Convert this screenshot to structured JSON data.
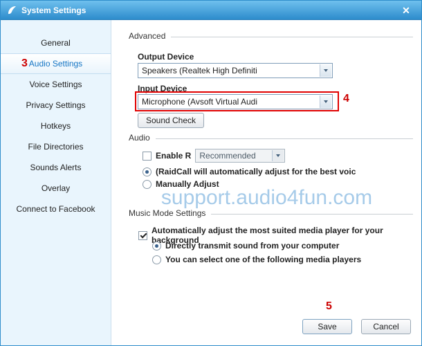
{
  "window": {
    "title": "System Settings",
    "close_label": "✕"
  },
  "sidebar": {
    "items": [
      {
        "label": "General",
        "selected": false
      },
      {
        "label": "Audio Settings",
        "selected": true
      },
      {
        "label": "Voice Settings",
        "selected": false
      },
      {
        "label": "Privacy Settings",
        "selected": false
      },
      {
        "label": "Hotkeys",
        "selected": false
      },
      {
        "label": "File Directories",
        "selected": false
      },
      {
        "label": "Sounds Alerts",
        "selected": false
      },
      {
        "label": "Overlay",
        "selected": false
      },
      {
        "label": "Connect to Facebook",
        "selected": false
      }
    ]
  },
  "annotations": {
    "step3": "3",
    "step4": "4",
    "step5": "5"
  },
  "content": {
    "advanced": {
      "header": "Advanced",
      "output_label": "Output Device",
      "output_value": "Speakers (Realtek High Definiti",
      "input_label": "Input Device",
      "input_value": "Microphone (Avsoft Virtual Audi",
      "sound_check": "Sound Check"
    },
    "audio": {
      "header": "Audio",
      "enable_label": "Enable R",
      "recommended_value": "Recommended",
      "auto_label": "(RaidCall will automatically adjust for the best voic",
      "manual_label": "Manually Adjust"
    },
    "watermark": "support.audio4fun.com",
    "music": {
      "header": "Music Mode Settings",
      "auto_label": "Automatically adjust the most suited media player for your background",
      "direct_label": "Directly transmit sound from your computer",
      "select_label": "You can select one of the following media players"
    }
  },
  "footer": {
    "save": "Save",
    "cancel": "Cancel"
  },
  "colors": {
    "titlebar_top": "#6fc0ee",
    "titlebar_bottom": "#2d8ccc",
    "sidebar_bg": "#e9f5fd",
    "selected_text": "#1374c4",
    "annotation_red": "#cc0000",
    "watermark": "#a6cbe9"
  }
}
